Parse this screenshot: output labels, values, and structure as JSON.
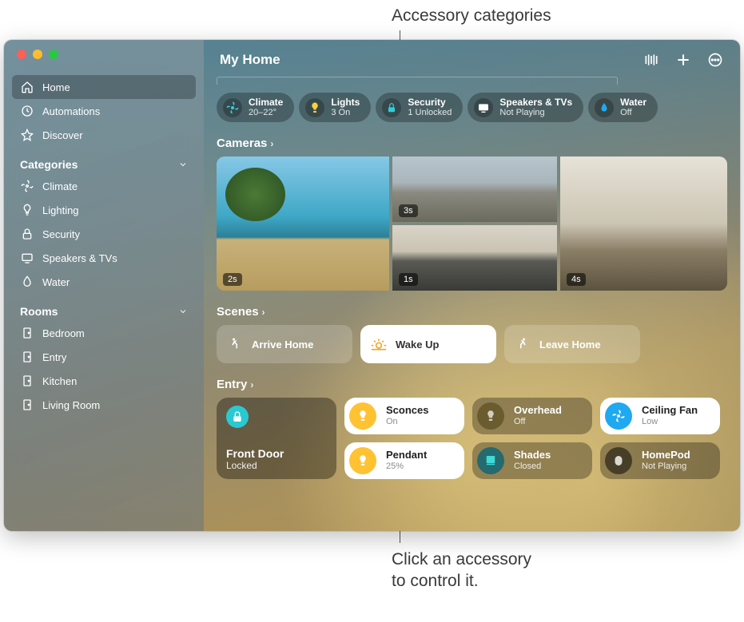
{
  "callouts": {
    "top": "Accessory categories",
    "bottom_line1": "Click an accessory",
    "bottom_line2": "to control it."
  },
  "window": {
    "title": "My Home"
  },
  "sidebar": {
    "nav": [
      {
        "label": "Home",
        "icon": "house-icon",
        "active": true
      },
      {
        "label": "Automations",
        "icon": "clock-arrow-icon",
        "active": false
      },
      {
        "label": "Discover",
        "icon": "star-icon",
        "active": false
      }
    ],
    "sections": [
      {
        "title": "Categories",
        "items": [
          {
            "label": "Climate",
            "icon": "fan-icon"
          },
          {
            "label": "Lighting",
            "icon": "bulb-icon"
          },
          {
            "label": "Security",
            "icon": "lock-icon"
          },
          {
            "label": "Speakers & TVs",
            "icon": "tv-icon"
          },
          {
            "label": "Water",
            "icon": "drop-icon"
          }
        ]
      },
      {
        "title": "Rooms",
        "items": [
          {
            "label": "Bedroom",
            "icon": "door-icon"
          },
          {
            "label": "Entry",
            "icon": "door-icon"
          },
          {
            "label": "Kitchen",
            "icon": "door-icon"
          },
          {
            "label": "Living Room",
            "icon": "door-icon"
          }
        ]
      }
    ]
  },
  "category_pills": [
    {
      "title": "Climate",
      "subtitle": "20–22°",
      "icon": "fan-icon",
      "color": "#36d0dc"
    },
    {
      "title": "Lights",
      "subtitle": "3 On",
      "icon": "bulb-icon",
      "color": "#ffcf3a"
    },
    {
      "title": "Security",
      "subtitle": "1 Unlocked",
      "icon": "lock-icon",
      "color": "#2ecddc"
    },
    {
      "title": "Speakers & TVs",
      "subtitle": "Not Playing",
      "icon": "tv-icon",
      "color": "#ffffff"
    },
    {
      "title": "Water",
      "subtitle": "Off",
      "icon": "drop-icon",
      "color": "#1fa9f0"
    }
  ],
  "sections": {
    "cameras": {
      "title": "Cameras",
      "feeds": [
        {
          "label": "2s"
        },
        {
          "label": "3s"
        },
        {
          "label": "1s"
        },
        {
          "label": "4s"
        }
      ]
    },
    "scenes": {
      "title": "Scenes",
      "items": [
        {
          "label": "Arrive Home",
          "icon": "person-walk-icon",
          "active": false
        },
        {
          "label": "Wake Up",
          "icon": "sunrise-icon",
          "active": true
        },
        {
          "label": "Leave Home",
          "icon": "person-leave-icon",
          "active": false
        }
      ]
    },
    "entry": {
      "title": "Entry",
      "front_door": {
        "title": "Front Door",
        "subtitle": "Locked",
        "icon": "lock-icon"
      },
      "tiles": [
        {
          "title": "Sconces",
          "subtitle": "On",
          "icon": "light-icon",
          "state": "on",
          "iconClass": "ic-yellow"
        },
        {
          "title": "Overhead",
          "subtitle": "Off",
          "icon": "light-icon",
          "state": "off",
          "iconClass": "ic-dimY"
        },
        {
          "title": "Ceiling Fan",
          "subtitle": "Low",
          "icon": "fan-icon",
          "state": "on",
          "iconClass": "ic-blue"
        },
        {
          "title": "Pendant",
          "subtitle": "25%",
          "icon": "light-icon",
          "state": "on",
          "iconClass": "ic-yellow"
        },
        {
          "title": "Shades",
          "subtitle": "Closed",
          "icon": "shades-icon",
          "state": "off",
          "iconClass": "ic-teal"
        },
        {
          "title": "HomePod",
          "subtitle": "Not Playing",
          "icon": "homepod-icon",
          "state": "off",
          "iconClass": "ic-dim"
        }
      ]
    }
  }
}
